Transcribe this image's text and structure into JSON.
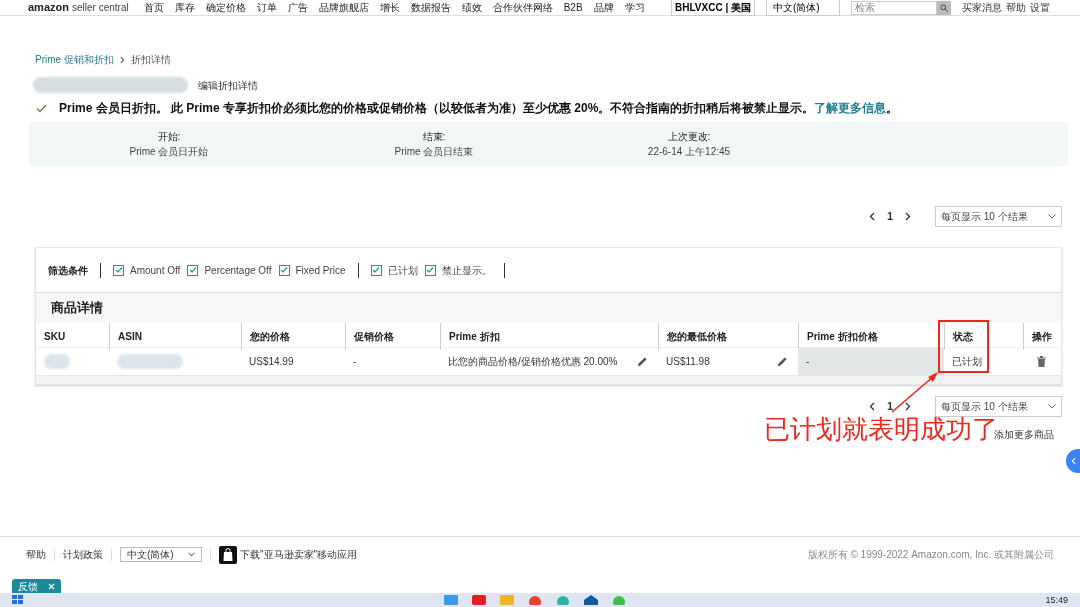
{
  "top_nav": {
    "logo": {
      "brand": "amazon",
      "product": "seller central"
    },
    "items": [
      "首页",
      "库存",
      "确定价格",
      "订单",
      "广告",
      "品牌旗舰店",
      "增长",
      "数据报告",
      "绩效",
      "合作伙伴网络",
      "B2B",
      "品牌",
      "学习"
    ],
    "account": "BHLVXCC | 美国",
    "language": "中文(简体)",
    "search": {
      "placeholder": "检索"
    },
    "links": [
      "买家消息",
      "帮助",
      "设置"
    ]
  },
  "breadcrumb": [
    {
      "label": "Prime 促销和折扣",
      "kind": "link"
    },
    {
      "label": "折扣详情",
      "kind": "current"
    }
  ],
  "edit_link": "编辑折扣详情",
  "notice": {
    "text": "Prime 会员日折扣。 此 Prime 专享折扣价必须比您的价格或促销价格（以较低者为准）至少优惠 20%。不符合指南的折扣稍后将被禁止显示。",
    "link": "了解更多信息",
    "end": "。"
  },
  "info": [
    {
      "label": "开始:",
      "value": "Prime 会员日开始"
    },
    {
      "label": "结束:",
      "value": "Prime 会员日结束"
    },
    {
      "label": "上次更改:",
      "value": "22-6-14 上午12:45"
    }
  ],
  "pager_top": {
    "page": "1",
    "per_page": "每页显示 10 个结果"
  },
  "filters": {
    "label": "筛选条件",
    "groups": [
      [
        {
          "label": "Amount Off",
          "checked": true
        },
        {
          "label": "Percentage Off",
          "checked": true
        },
        {
          "label": "Fixed Price",
          "checked": true
        }
      ],
      [
        {
          "label": "已计划",
          "checked": true
        },
        {
          "label": "禁止显示。",
          "checked": true
        }
      ]
    ]
  },
  "table": {
    "title": "商品详情",
    "columns": [
      "SKU",
      "ASIN",
      "您的价格",
      "促销价格",
      "Prime 折扣",
      "您的最低价格",
      "Prime 折扣价格",
      "状态",
      "操作"
    ],
    "rows": [
      {
        "cells": [
          {
            "kind": "blurred"
          },
          {
            "kind": "blurred"
          },
          {
            "kind": "text",
            "text": "US$14.99"
          },
          {
            "kind": "text",
            "text": "-"
          },
          {
            "kind": "editable",
            "text": "比您的商品价格/促销价格优惠 20.00%"
          },
          {
            "kind": "editable",
            "text": "US$11.98"
          },
          {
            "kind": "disabled",
            "text": "-"
          },
          {
            "kind": "text",
            "text": "已计划"
          },
          {
            "kind": "delete"
          }
        ]
      }
    ]
  },
  "pager_bottom": {
    "page": "1",
    "per_page": "每页显示 10 个结果"
  },
  "annotation": {
    "text": "已计划就表明成功了"
  },
  "add_more": "添加更多商品",
  "footer": {
    "links": [
      "帮助",
      "计划政策"
    ],
    "language": "中文(简体)",
    "app_text": "下载\"亚马逊卖家\"移动应用",
    "copyright": "版权所有 © 1999-2022 Amazon.com, Inc. 或其附属公司"
  },
  "feedback_tab": "反馈",
  "taskbar": {
    "time": "15:49"
  }
}
